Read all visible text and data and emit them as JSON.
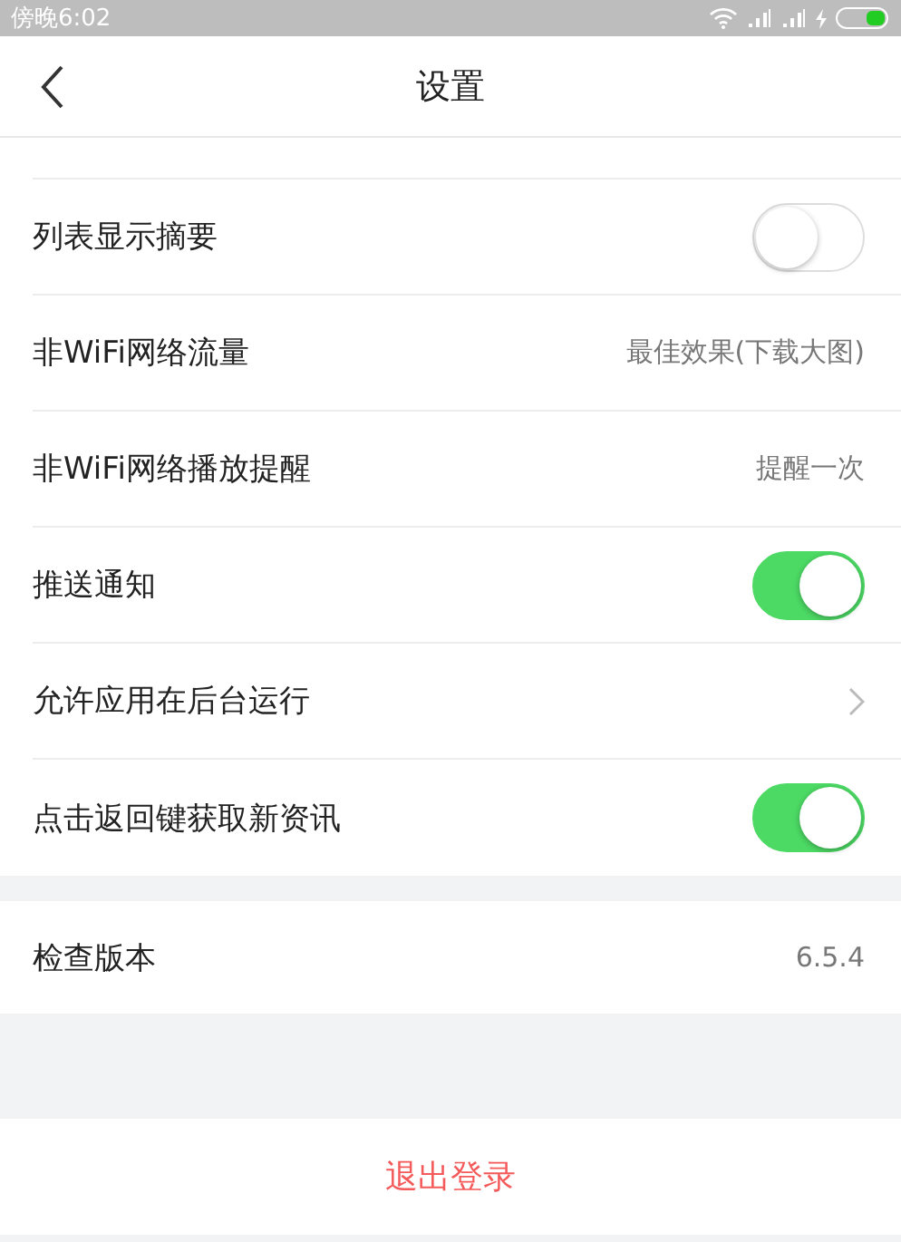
{
  "status_bar": {
    "time": "傍晚6:02"
  },
  "nav": {
    "title": "设置"
  },
  "settings": [
    {
      "kind": "toggle",
      "label": "列表显示摘要",
      "on": false
    },
    {
      "kind": "value",
      "label": "非WiFi网络流量",
      "value": "最佳效果(下载大图)"
    },
    {
      "kind": "value",
      "label": "非WiFi网络播放提醒",
      "value": "提醒一次"
    },
    {
      "kind": "toggle",
      "label": "推送通知",
      "on": true
    },
    {
      "kind": "arrow",
      "label": "允许应用在后台运行"
    },
    {
      "kind": "toggle",
      "label": "点击返回键获取新资讯",
      "on": true
    }
  ],
  "version": {
    "label": "检查版本",
    "value": "6.5.4"
  },
  "logout": {
    "label": "退出登录"
  }
}
